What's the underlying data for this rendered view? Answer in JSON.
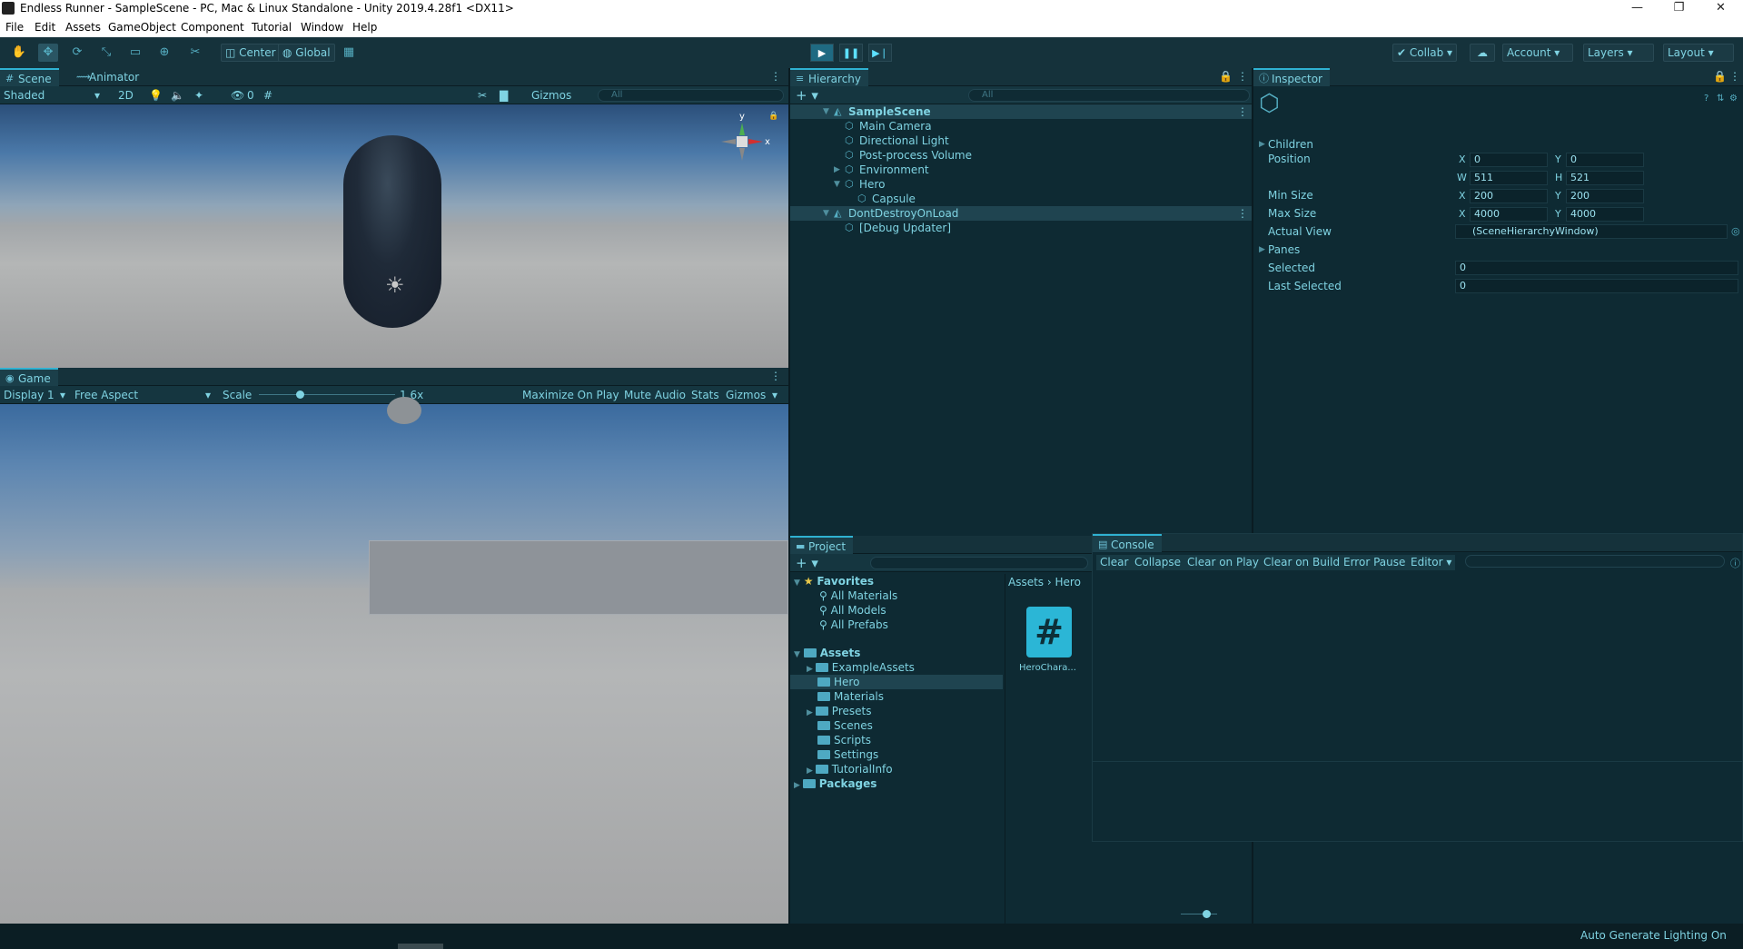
{
  "window": {
    "title": "Endless Runner - SampleScene - PC, Mac & Linux Standalone - Unity 2019.4.28f1 <DX11>",
    "minimize": "—",
    "restore": "❐",
    "close": "✕"
  },
  "menu": [
    "File",
    "Edit",
    "Assets",
    "GameObject",
    "Component",
    "Tutorial",
    "Window",
    "Help"
  ],
  "toolbar": {
    "pivot": "Center",
    "space": "Global",
    "collab": "Collab",
    "account": "Account",
    "layers": "Layers",
    "layout": "Layout"
  },
  "scene": {
    "tabs": [
      "Scene",
      "Animator"
    ],
    "shading": "Shaded",
    "mode2d": "2D",
    "hidden_count": "0",
    "gizmos": "Gizmos",
    "search_placeholder": "All",
    "axis_y": "y",
    "axis_x": "x"
  },
  "game": {
    "tab": "Game",
    "display": "Display 1",
    "aspect": "Free Aspect",
    "scale_label": "Scale",
    "scale_value": "1.6x",
    "scale_fraction": 0.3,
    "maximize": "Maximize On Play",
    "mute": "Mute Audio",
    "stats": "Stats",
    "gizmos": "Gizmos"
  },
  "hierarchy": {
    "tab": "Hierarchy",
    "search_placeholder": "All",
    "rows": [
      {
        "label": "SampleScene",
        "depth": 0,
        "bold": true
      },
      {
        "label": "Main Camera",
        "depth": 1
      },
      {
        "label": "Directional Light",
        "depth": 1
      },
      {
        "label": "Post-process Volume",
        "depth": 1
      },
      {
        "label": "Environment",
        "depth": 1
      },
      {
        "label": "Hero",
        "depth": 1
      },
      {
        "label": "Capsule",
        "depth": 2
      },
      {
        "label": "DontDestroyOnLoad",
        "depth": 0
      },
      {
        "label": "[Debug Updater]",
        "depth": 1
      }
    ]
  },
  "inspector": {
    "tab": "Inspector",
    "children": "Children",
    "position": "Position",
    "pos_x": "0",
    "pos_y": "0",
    "pos_w": "511",
    "pos_h": "521",
    "min_size": "Min Size",
    "min_x": "200",
    "min_y": "200",
    "max_size": "Max Size",
    "max_x": "4000",
    "max_y": "4000",
    "actual_view": "Actual View",
    "actual_view_value": "(SceneHierarchyWindow)",
    "panes": "Panes",
    "selected": "Selected",
    "selected_value": "0",
    "last_selected": "Last Selected",
    "last_selected_value": "0",
    "lab_x": "X",
    "lab_y": "Y",
    "lab_w": "W",
    "lab_h": "H"
  },
  "project": {
    "tab": "Project",
    "favorites": "Favorites",
    "fav_items": [
      "All Materials",
      "All Models",
      "All Prefabs"
    ],
    "assets": "Assets",
    "asset_folders": [
      "ExampleAssets",
      "Hero",
      "Materials",
      "Presets",
      "Scenes",
      "Scripts",
      "Settings",
      "TutorialInfo"
    ],
    "packages": "Packages",
    "breadcrumb_root": "Assets",
    "breadcrumb_leaf": "Hero",
    "file_name": "HeroChara..."
  },
  "console": {
    "tab": "Console",
    "buttons": [
      "Clear",
      "Collapse",
      "Clear on Play",
      "Clear on Build",
      "Error Pause",
      "Editor"
    ]
  },
  "status": {
    "text": "Auto Generate Lighting On"
  }
}
